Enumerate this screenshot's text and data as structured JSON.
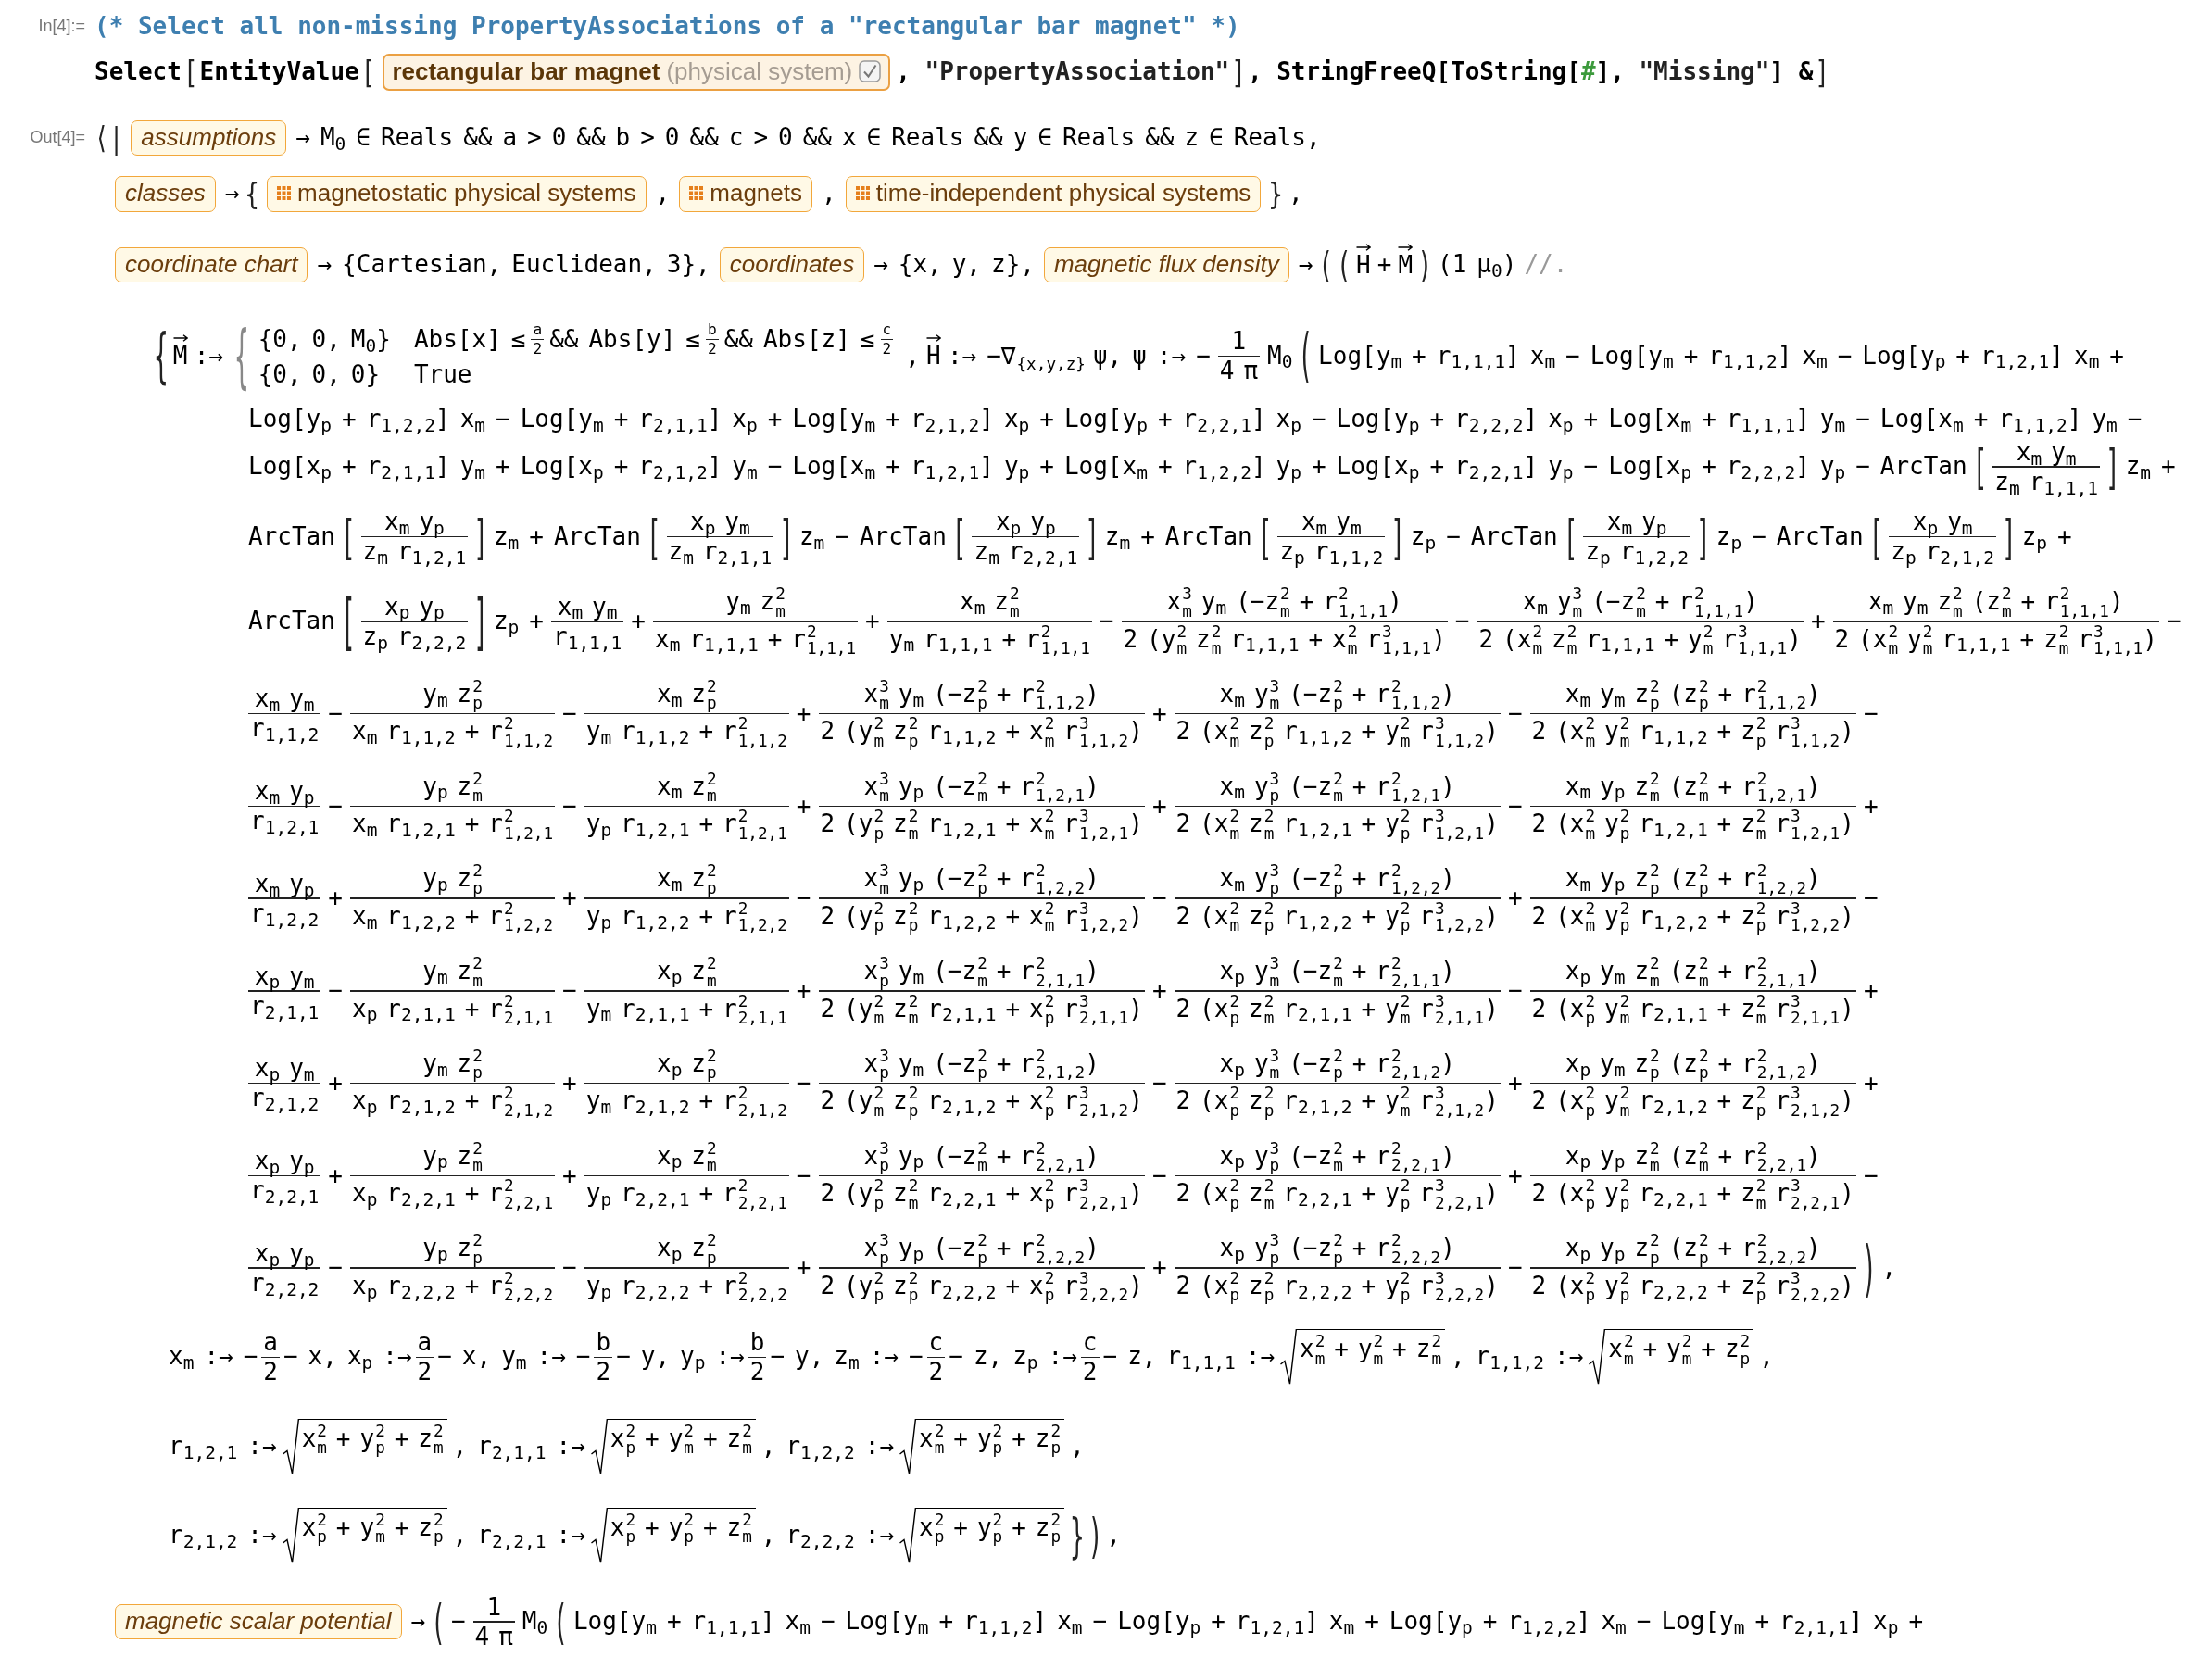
{
  "input_cell": {
    "label": "In[4]:=",
    "lines": [
      {
        "kind": "code",
        "tokens": [
          {
            "kind": "comment",
            "text": "(* Select all non-missing PropertyAssociations of a \"rectangular bar magnet\" *)"
          }
        ]
      },
      {
        "kind": "code",
        "tokens": [
          {
            "kind": "code",
            "text": "Select"
          },
          {
            "kind": "delim",
            "text": "["
          },
          {
            "kind": "code",
            "text": "EntityValue"
          },
          {
            "kind": "delim",
            "text": "["
          },
          {
            "kind": "instance",
            "label": "rectangular bar magnet",
            "qualifier": "(physical system)",
            "verified": true
          },
          {
            "kind": "code",
            "text": ","
          },
          {
            "kind": "string",
            "text": "\"PropertyAssociation\""
          },
          {
            "kind": "delim",
            "text": "]"
          },
          {
            "kind": "code",
            "text": ", StringFreeQ[ToString["
          },
          {
            "kind": "slot",
            "text": "#"
          },
          {
            "kind": "code",
            "text": "],"
          },
          {
            "kind": "string",
            "text": "\"Missing\""
          },
          {
            "kind": "code",
            "text": "] &"
          },
          {
            "kind": "delim",
            "text": "]"
          }
        ]
      }
    ]
  },
  "output_cell": {
    "label": "Out[4]=",
    "lines": [
      {
        "kind": "first",
        "tokens": [
          {
            "kind": "delim",
            "text": "⟨|"
          },
          {
            "kind": "property",
            "label": "assumptions"
          },
          {
            "kind": "text",
            "text": "→ M$_{0}$ ∈ Reals && a > 0 && b > 0 && c > 0 && x ∈ Reals && y ∈ Reals && z ∈ Reals,"
          }
        ]
      },
      {
        "kind": "rule",
        "tokens": [
          {
            "kind": "property",
            "label": "classes"
          },
          {
            "kind": "text",
            "text": "→"
          },
          {
            "kind": "delim",
            "text": "{"
          },
          {
            "kind": "class",
            "label": "magnetostatic physical systems"
          },
          {
            "kind": "text",
            "text": ","
          },
          {
            "kind": "class",
            "label": "magnets"
          },
          {
            "kind": "text",
            "text": ","
          },
          {
            "kind": "class",
            "label": "time-independent physical systems"
          },
          {
            "kind": "delim",
            "text": "}"
          },
          {
            "kind": "text",
            "text": ","
          }
        ]
      },
      {
        "kind": "rule",
        "tokens": [
          {
            "kind": "property",
            "label": "coordinate chart"
          },
          {
            "kind": "text",
            "text": "→ {Cartesian, Euclidean, 3},"
          },
          {
            "kind": "property",
            "label": "coordinates"
          },
          {
            "kind": "text",
            "text": "→ {x, y, z},"
          },
          {
            "kind": "property",
            "label": "magnetic flux density"
          },
          {
            "kind": "text",
            "text": "→"
          },
          {
            "kind": "delim",
            "text": "("
          },
          {
            "kind": "delim",
            "text": "("
          },
          {
            "kind": "vector",
            "text": "H"
          },
          {
            "kind": "text",
            "text": "+"
          },
          {
            "kind": "vector",
            "text": "M"
          },
          {
            "kind": "delim",
            "text": ")"
          },
          {
            "kind": "text",
            "text": "(1 μ$_{0}$)"
          },
          {
            "kind": "dim",
            "text": "//."
          }
        ]
      },
      {
        "kind": "assoc",
        "tokens": [
          {
            "kind": "delim",
            "text": "{"
          },
          {
            "kind": "vector",
            "text": "M"
          },
          {
            "kind": "text",
            "text": ":→"
          },
          {
            "kind": "piecewise",
            "open": "{",
            "cases": [
              {
                "value": "{0, 0, M$_{0}$}",
                "condition": [
                  {
                    "kind": "text",
                    "text": "Abs[x] ≤"
                  },
                  {
                    "kind": "frac",
                    "num": "a",
                    "den": "2"
                  },
                  {
                    "kind": "text",
                    "text": "&& Abs[y] ≤"
                  },
                  {
                    "kind": "frac",
                    "num": "b",
                    "den": "2"
                  },
                  {
                    "kind": "text",
                    "text": "&& Abs[z] ≤"
                  },
                  {
                    "kind": "frac",
                    "num": "c",
                    "den": "2"
                  }
                ]
              },
              {
                "value": "{0, 0, 0}",
                "condition": [
                  {
                    "kind": "text",
                    "text": "True"
                  }
                ]
              }
            ]
          },
          {
            "kind": "text",
            "text": ","
          },
          {
            "kind": "vector",
            "text": "H"
          },
          {
            "kind": "text",
            "text": ":→ −∇"
          },
          {
            "kind": "subscript",
            "text": "{x,y,z}"
          },
          {
            "kind": "text",
            "text": "ψ, ψ :→ −"
          },
          {
            "kind": "frac",
            "num": "1",
            "den": "4 π"
          },
          {
            "kind": "text",
            "text": "M$_{0}$"
          },
          {
            "kind": "delim",
            "text": "("
          },
          {
            "kind": "text",
            "text": "Log[y$_{m}$ + r$_{1,1,1}$] x$_{m}$ − Log[y$_{m}$ + r$_{1,1,2}$] x$_{m}$ − Log[y$_{p}$ + r$_{1,2,1}$] x$_{m}$ +"
          }
        ]
      },
      {
        "kind": "term",
        "tokens": [
          {
            "kind": "text",
            "text": "Log[y$_{p}$ + r$_{1,2,2}$] x$_{m}$ − Log[y$_{m}$ + r$_{2,1,1}$] x$_{p}$ + Log[y$_{m}$ + r$_{2,1,2}$] x$_{p}$ + Log[y$_{p}$ + r$_{2,2,1}$] x$_{p}$ − Log[y$_{p}$ + r$_{2,2,2}$] x$_{p}$ + Log[x$_{m}$ + r$_{1,1,1}$] y$_{m}$ − Log[x$_{m}$ + r$_{1,1,2}$] y$_{m}$ −"
          }
        ]
      },
      {
        "kind": "term",
        "tokens": [
          {
            "kind": "text",
            "text": "Log[x$_{p}$ + r$_{2,1,1}$] y$_{m}$ + Log[x$_{p}$ + r$_{2,1,2}$] y$_{m}$ − Log[x$_{m}$ + r$_{1,2,1}$] y$_{p}$ + Log[x$_{m}$ + r$_{1,2,2}$] y$_{p}$ + Log[x$_{p}$ + r$_{2,2,1}$] y$_{p}$ − Log[x$_{p}$ + r$_{2,2,2}$] y$_{p}$ − ArcTan"
          },
          {
            "kind": "delim",
            "text": "["
          },
          {
            "kind": "frac",
            "num": "x$_{m}$ y$_{m}$",
            "den": "z$_{m}$ r$_{1,1,1}$"
          },
          {
            "kind": "delim",
            "text": "]"
          },
          {
            "kind": "text",
            "text": "z$_{m}$ +"
          }
        ]
      },
      {
        "kind": "term",
        "tokens": [
          {
            "kind": "text",
            "text": "ArcTan"
          },
          {
            "kind": "delim",
            "text": "["
          },
          {
            "kind": "frac",
            "num": "x$_{m}$ y$_{p}$",
            "den": "z$_{m}$ r$_{1,2,1}$"
          },
          {
            "kind": "delim",
            "text": "]"
          },
          {
            "kind": "text",
            "text": "z$_{m}$ + ArcTan"
          },
          {
            "kind": "delim",
            "text": "["
          },
          {
            "kind": "frac",
            "num": "x$_{p}$ y$_{m}$",
            "den": "z$_{m}$ r$_{2,1,1}$"
          },
          {
            "kind": "delim",
            "text": "]"
          },
          {
            "kind": "text",
            "text": "z$_{m}$ − ArcTan"
          },
          {
            "kind": "delim",
            "text": "["
          },
          {
            "kind": "frac",
            "num": "x$_{p}$ y$_{p}$",
            "den": "z$_{m}$ r$_{2,2,1}$"
          },
          {
            "kind": "delim",
            "text": "]"
          },
          {
            "kind": "text",
            "text": "z$_{m}$ + ArcTan"
          },
          {
            "kind": "delim",
            "text": "["
          },
          {
            "kind": "frac",
            "num": "x$_{m}$ y$_{m}$",
            "den": "z$_{p}$ r$_{1,1,2}$"
          },
          {
            "kind": "delim",
            "text": "]"
          },
          {
            "kind": "text",
            "text": "z$_{p}$ − ArcTan"
          },
          {
            "kind": "delim",
            "text": "["
          },
          {
            "kind": "frac",
            "num": "x$_{m}$ y$_{p}$",
            "den": "z$_{p}$ r$_{1,2,2}$"
          },
          {
            "kind": "delim",
            "text": "]"
          },
          {
            "kind": "text",
            "text": "z$_{p}$ − ArcTan"
          },
          {
            "kind": "delim",
            "text": "["
          },
          {
            "kind": "frac",
            "num": "x$_{p}$ y$_{m}$",
            "den": "z$_{p}$ r$_{2,1,2}$"
          },
          {
            "kind": "delim",
            "text": "]"
          },
          {
            "kind": "text",
            "text": "z$_{p}$ +"
          }
        ]
      },
      {
        "kind": "term",
        "tokens": [
          {
            "kind": "text",
            "text": "ArcTan"
          },
          {
            "kind": "delim",
            "text": "["
          },
          {
            "kind": "frac",
            "num": "x$_{p}$ y$_{p}$",
            "den": "z$_{p}$ r$_{2,2,2}$"
          },
          {
            "kind": "delim",
            "text": "]"
          },
          {
            "kind": "text",
            "text": "z$_{p}$ +"
          },
          {
            "kind": "frac",
            "num": "x$_{m}$ y$_{m}$",
            "den": "r$_{1,1,1}$"
          },
          {
            "kind": "text",
            "text": "+"
          },
          {
            "kind": "frac",
            "num": "y$_{m}$ z$_{m}$$^{2}$",
            "den": "x$_{m}$ r$_{1,1,1}$ + r$_{1,1,1}$$^{2}$"
          },
          {
            "kind": "text",
            "text": "+"
          },
          {
            "kind": "frac",
            "num": "x$_{m}$ z$_{m}$$^{2}$",
            "den": "y$_{m}$ r$_{1,1,1}$ + r$_{1,1,1}$$^{2}$"
          },
          {
            "kind": "text",
            "text": "−"
          },
          {
            "kind": "frac",
            "num": "x$_{m}$$^{3}$ y$_{m}$ (−z$_{m}$$^{2}$ + r$_{1,1,1}$$^{2}$)",
            "den": "2 (y$_{m}$$^{2}$ z$_{m}$$^{2}$ r$_{1,1,1}$ + x$_{m}$$^{2}$ r$_{1,1,1}$$^{3}$)"
          },
          {
            "kind": "text",
            "text": "−"
          },
          {
            "kind": "frac",
            "num": "x$_{m}$ y$_{m}$$^{3}$ (−z$_{m}$$^{2}$ + r$_{1,1,1}$$^{2}$)",
            "den": "2 (x$_{m}$$^{2}$ z$_{m}$$^{2}$ r$_{1,1,1}$ + y$_{m}$$^{2}$ r$_{1,1,1}$$^{3}$)"
          },
          {
            "kind": "text",
            "text": "+"
          },
          {
            "kind": "frac",
            "num": "x$_{m}$ y$_{m}$ z$_{m}$$^{2}$ (z$_{m}$$^{2}$ + r$_{1,1,1}$$^{2}$)",
            "den": "2 (x$_{m}$$^{2}$ y$_{m}$$^{2}$ r$_{1,1,1}$ + z$_{m}$$^{2}$ r$_{1,1,1}$$^{3}$)"
          },
          {
            "kind": "text",
            "text": "−"
          }
        ]
      },
      {
        "kind": "term",
        "tokens": [
          {
            "kind": "frac",
            "num": "x$_{m}$ y$_{m}$",
            "den": "r$_{1,1,2}$"
          },
          {
            "kind": "text",
            "text": "−"
          },
          {
            "kind": "frac",
            "num": "y$_{m}$ z$_{p}$$^{2}$",
            "den": "x$_{m}$ r$_{1,1,2}$ + r$_{1,1,2}$$^{2}$"
          },
          {
            "kind": "text",
            "text": "−"
          },
          {
            "kind": "frac",
            "num": "x$_{m}$ z$_{p}$$^{2}$",
            "den": "y$_{m}$ r$_{1,1,2}$ + r$_{1,1,2}$$^{2}$"
          },
          {
            "kind": "text",
            "text": "+"
          },
          {
            "kind": "frac",
            "num": "x$_{m}$$^{3}$ y$_{m}$ (−z$_{p}$$^{2}$ + r$_{1,1,2}$$^{2}$)",
            "den": "2 (y$_{m}$$^{2}$ z$_{p}$$^{2}$ r$_{1,1,2}$ + x$_{m}$$^{2}$ r$_{1,1,2}$$^{3}$)"
          },
          {
            "kind": "text",
            "text": "+"
          },
          {
            "kind": "frac",
            "num": "x$_{m}$ y$_{m}$$^{3}$ (−z$_{p}$$^{2}$ + r$_{1,1,2}$$^{2}$)",
            "den": "2 (x$_{m}$$^{2}$ z$_{p}$$^{2}$ r$_{1,1,2}$ + y$_{m}$$^{2}$ r$_{1,1,2}$$^{3}$)"
          },
          {
            "kind": "text",
            "text": "−"
          },
          {
            "kind": "frac",
            "num": "x$_{m}$ y$_{m}$ z$_{p}$$^{2}$ (z$_{p}$$^{2}$ + r$_{1,1,2}$$^{2}$)",
            "den": "2 (x$_{m}$$^{2}$ y$_{m}$$^{2}$ r$_{1,1,2}$ + z$_{p}$$^{2}$ r$_{1,1,2}$$^{3}$)"
          },
          {
            "kind": "text",
            "text": "−"
          }
        ]
      },
      {
        "kind": "term",
        "tokens": [
          {
            "kind": "frac",
            "num": "x$_{m}$ y$_{p}$",
            "den": "r$_{1,2,1}$"
          },
          {
            "kind": "text",
            "text": "−"
          },
          {
            "kind": "frac",
            "num": "y$_{p}$ z$_{m}$$^{2}$",
            "den": "x$_{m}$ r$_{1,2,1}$ + r$_{1,2,1}$$^{2}$"
          },
          {
            "kind": "text",
            "text": "−"
          },
          {
            "kind": "frac",
            "num": "x$_{m}$ z$_{m}$$^{2}$",
            "den": "y$_{p}$ r$_{1,2,1}$ + r$_{1,2,1}$$^{2}$"
          },
          {
            "kind": "text",
            "text": "+"
          },
          {
            "kind": "frac",
            "num": "x$_{m}$$^{3}$ y$_{p}$ (−z$_{m}$$^{2}$ + r$_{1,2,1}$$^{2}$)",
            "den": "2 (y$_{p}$$^{2}$ z$_{m}$$^{2}$ r$_{1,2,1}$ + x$_{m}$$^{2}$ r$_{1,2,1}$$^{3}$)"
          },
          {
            "kind": "text",
            "text": "+"
          },
          {
            "kind": "frac",
            "num": "x$_{m}$ y$_{p}$$^{3}$ (−z$_{m}$$^{2}$ + r$_{1,2,1}$$^{2}$)",
            "den": "2 (x$_{m}$$^{2}$ z$_{m}$$^{2}$ r$_{1,2,1}$ + y$_{p}$$^{2}$ r$_{1,2,1}$$^{3}$)"
          },
          {
            "kind": "text",
            "text": "−"
          },
          {
            "kind": "frac",
            "num": "x$_{m}$ y$_{p}$ z$_{m}$$^{2}$ (z$_{m}$$^{2}$ + r$_{1,2,1}$$^{2}$)",
            "den": "2 (x$_{m}$$^{2}$ y$_{p}$$^{2}$ r$_{1,2,1}$ + z$_{m}$$^{2}$ r$_{1,2,1}$$^{3}$)"
          },
          {
            "kind": "text",
            "text": "+"
          }
        ]
      },
      {
        "kind": "term",
        "tokens": [
          {
            "kind": "frac",
            "num": "x$_{m}$ y$_{p}$",
            "den": "r$_{1,2,2}$"
          },
          {
            "kind": "text",
            "text": "+"
          },
          {
            "kind": "frac",
            "num": "y$_{p}$ z$_{p}$$^{2}$",
            "den": "x$_{m}$ r$_{1,2,2}$ + r$_{1,2,2}$$^{2}$"
          },
          {
            "kind": "text",
            "text": "+"
          },
          {
            "kind": "frac",
            "num": "x$_{m}$ z$_{p}$$^{2}$",
            "den": "y$_{p}$ r$_{1,2,2}$ + r$_{1,2,2}$$^{2}$"
          },
          {
            "kind": "text",
            "text": "−"
          },
          {
            "kind": "frac",
            "num": "x$_{m}$$^{3}$ y$_{p}$ (−z$_{p}$$^{2}$ + r$_{1,2,2}$$^{2}$)",
            "den": "2 (y$_{p}$$^{2}$ z$_{p}$$^{2}$ r$_{1,2,2}$ + x$_{m}$$^{2}$ r$_{1,2,2}$$^{3}$)"
          },
          {
            "kind": "text",
            "text": "−"
          },
          {
            "kind": "frac",
            "num": "x$_{m}$ y$_{p}$$^{3}$ (−z$_{p}$$^{2}$ + r$_{1,2,2}$$^{2}$)",
            "den": "2 (x$_{m}$$^{2}$ z$_{p}$$^{2}$ r$_{1,2,2}$ + y$_{p}$$^{2}$ r$_{1,2,2}$$^{3}$)"
          },
          {
            "kind": "text",
            "text": "+"
          },
          {
            "kind": "frac",
            "num": "x$_{m}$ y$_{p}$ z$_{p}$$^{2}$ (z$_{p}$$^{2}$ + r$_{1,2,2}$$^{2}$)",
            "den": "2 (x$_{m}$$^{2}$ y$_{p}$$^{2}$ r$_{1,2,2}$ + z$_{p}$$^{2}$ r$_{1,2,2}$$^{3}$)"
          },
          {
            "kind": "text",
            "text": "−"
          }
        ]
      },
      {
        "kind": "term",
        "tokens": [
          {
            "kind": "frac",
            "num": "x$_{p}$ y$_{m}$",
            "den": "r$_{2,1,1}$"
          },
          {
            "kind": "text",
            "text": "−"
          },
          {
            "kind": "frac",
            "num": "y$_{m}$ z$_{m}$$^{2}$",
            "den": "x$_{p}$ r$_{2,1,1}$ + r$_{2,1,1}$$^{2}$"
          },
          {
            "kind": "text",
            "text": "−"
          },
          {
            "kind": "frac",
            "num": "x$_{p}$ z$_{m}$$^{2}$",
            "den": "y$_{m}$ r$_{2,1,1}$ + r$_{2,1,1}$$^{2}$"
          },
          {
            "kind": "text",
            "text": "+"
          },
          {
            "kind": "frac",
            "num": "x$_{p}$$^{3}$ y$_{m}$ (−z$_{m}$$^{2}$ + r$_{2,1,1}$$^{2}$)",
            "den": "2 (y$_{m}$$^{2}$ z$_{m}$$^{2}$ r$_{2,1,1}$ + x$_{p}$$^{2}$ r$_{2,1,1}$$^{3}$)"
          },
          {
            "kind": "text",
            "text": "+"
          },
          {
            "kind": "frac",
            "num": "x$_{p}$ y$_{m}$$^{3}$ (−z$_{m}$$^{2}$ + r$_{2,1,1}$$^{2}$)",
            "den": "2 (x$_{p}$$^{2}$ z$_{m}$$^{2}$ r$_{2,1,1}$ + y$_{m}$$^{2}$ r$_{2,1,1}$$^{3}$)"
          },
          {
            "kind": "text",
            "text": "−"
          },
          {
            "kind": "frac",
            "num": "x$_{p}$ y$_{m}$ z$_{m}$$^{2}$ (z$_{m}$$^{2}$ + r$_{2,1,1}$$^{2}$)",
            "den": "2 (x$_{p}$$^{2}$ y$_{m}$$^{2}$ r$_{2,1,1}$ + z$_{m}$$^{2}$ r$_{2,1,1}$$^{3}$)"
          },
          {
            "kind": "text",
            "text": "+"
          }
        ]
      },
      {
        "kind": "term",
        "tokens": [
          {
            "kind": "frac",
            "num": "x$_{p}$ y$_{m}$",
            "den": "r$_{2,1,2}$"
          },
          {
            "kind": "text",
            "text": "+"
          },
          {
            "kind": "frac",
            "num": "y$_{m}$ z$_{p}$$^{2}$",
            "den": "x$_{p}$ r$_{2,1,2}$ + r$_{2,1,2}$$^{2}$"
          },
          {
            "kind": "text",
            "text": "+"
          },
          {
            "kind": "frac",
            "num": "x$_{p}$ z$_{p}$$^{2}$",
            "den": "y$_{m}$ r$_{2,1,2}$ + r$_{2,1,2}$$^{2}$"
          },
          {
            "kind": "text",
            "text": "−"
          },
          {
            "kind": "frac",
            "num": "x$_{p}$$^{3}$ y$_{m}$ (−z$_{p}$$^{2}$ + r$_{2,1,2}$$^{2}$)",
            "den": "2 (y$_{m}$$^{2}$ z$_{p}$$^{2}$ r$_{2,1,2}$ + x$_{p}$$^{2}$ r$_{2,1,2}$$^{3}$)"
          },
          {
            "kind": "text",
            "text": "−"
          },
          {
            "kind": "frac",
            "num": "x$_{p}$ y$_{m}$$^{3}$ (−z$_{p}$$^{2}$ + r$_{2,1,2}$$^{2}$)",
            "den": "2 (x$_{p}$$^{2}$ z$_{p}$$^{2}$ r$_{2,1,2}$ + y$_{m}$$^{2}$ r$_{2,1,2}$$^{3}$)"
          },
          {
            "kind": "text",
            "text": "+"
          },
          {
            "kind": "frac",
            "num": "x$_{p}$ y$_{m}$ z$_{p}$$^{2}$ (z$_{p}$$^{2}$ + r$_{2,1,2}$$^{2}$)",
            "den": "2 (x$_{p}$$^{2}$ y$_{m}$$^{2}$ r$_{2,1,2}$ + z$_{p}$$^{2}$ r$_{2,1,2}$$^{3}$)"
          },
          {
            "kind": "text",
            "text": "+"
          }
        ]
      },
      {
        "kind": "term",
        "tokens": [
          {
            "kind": "frac",
            "num": "x$_{p}$ y$_{p}$",
            "den": "r$_{2,2,1}$"
          },
          {
            "kind": "text",
            "text": "+"
          },
          {
            "kind": "frac",
            "num": "y$_{p}$ z$_{m}$$^{2}$",
            "den": "x$_{p}$ r$_{2,2,1}$ + r$_{2,2,1}$$^{2}$"
          },
          {
            "kind": "text",
            "text": "+"
          },
          {
            "kind": "frac",
            "num": "x$_{p}$ z$_{m}$$^{2}$",
            "den": "y$_{p}$ r$_{2,2,1}$ + r$_{2,2,1}$$^{2}$"
          },
          {
            "kind": "text",
            "text": "−"
          },
          {
            "kind": "frac",
            "num": "x$_{p}$$^{3}$ y$_{p}$ (−z$_{m}$$^{2}$ + r$_{2,2,1}$$^{2}$)",
            "den": "2 (y$_{p}$$^{2}$ z$_{m}$$^{2}$ r$_{2,2,1}$ + x$_{p}$$^{2}$ r$_{2,2,1}$$^{3}$)"
          },
          {
            "kind": "text",
            "text": "−"
          },
          {
            "kind": "frac",
            "num": "x$_{p}$ y$_{p}$$^{3}$ (−z$_{m}$$^{2}$ + r$_{2,2,1}$$^{2}$)",
            "den": "2 (x$_{p}$$^{2}$ z$_{m}$$^{2}$ r$_{2,2,1}$ + y$_{p}$$^{2}$ r$_{2,2,1}$$^{3}$)"
          },
          {
            "kind": "text",
            "text": "+"
          },
          {
            "kind": "frac",
            "num": "x$_{p}$ y$_{p}$ z$_{m}$$^{2}$ (z$_{m}$$^{2}$ + r$_{2,2,1}$$^{2}$)",
            "den": "2 (x$_{p}$$^{2}$ y$_{p}$$^{2}$ r$_{2,2,1}$ + z$_{m}$$^{2}$ r$_{2,2,1}$$^{3}$)"
          },
          {
            "kind": "text",
            "text": "−"
          }
        ]
      },
      {
        "kind": "term",
        "tokens": [
          {
            "kind": "frac",
            "num": "x$_{p}$ y$_{p}$",
            "den": "r$_{2,2,2}$"
          },
          {
            "kind": "text",
            "text": "−"
          },
          {
            "kind": "frac",
            "num": "y$_{p}$ z$_{p}$$^{2}$",
            "den": "x$_{p}$ r$_{2,2,2}$ + r$_{2,2,2}$$^{2}$"
          },
          {
            "kind": "text",
            "text": "−"
          },
          {
            "kind": "frac",
            "num": "x$_{p}$ z$_{p}$$^{2}$",
            "den": "y$_{p}$ r$_{2,2,2}$ + r$_{2,2,2}$$^{2}$"
          },
          {
            "kind": "text",
            "text": "+"
          },
          {
            "kind": "frac",
            "num": "x$_{p}$$^{3}$ y$_{p}$ (−z$_{p}$$^{2}$ + r$_{2,2,2}$$^{2}$)",
            "den": "2 (y$_{p}$$^{2}$ z$_{p}$$^{2}$ r$_{2,2,2}$ + x$_{p}$$^{2}$ r$_{2,2,2}$$^{3}$)"
          },
          {
            "kind": "text",
            "text": "+"
          },
          {
            "kind": "frac",
            "num": "x$_{p}$ y$_{p}$$^{3}$ (−z$_{p}$$^{2}$ + r$_{2,2,2}$$^{2}$)",
            "den": "2 (x$_{p}$$^{2}$ z$_{p}$$^{2}$ r$_{2,2,2}$ + y$_{p}$$^{2}$ r$_{2,2,2}$$^{3}$)"
          },
          {
            "kind": "text",
            "text": "−"
          },
          {
            "kind": "frac",
            "num": "x$_{p}$ y$_{p}$ z$_{p}$$^{2}$ (z$_{p}$$^{2}$ + r$_{2,2,2}$$^{2}$)",
            "den": "2 (x$_{p}$$^{2}$ y$_{p}$$^{2}$ r$_{2,2,2}$ + z$_{p}$$^{2}$ r$_{2,2,2}$$^{3}$)"
          },
          {
            "kind": "delim",
            "text": ")"
          },
          {
            "kind": "text",
            "text": ","
          }
        ]
      },
      {
        "kind": "def",
        "tokens": [
          {
            "kind": "text",
            "text": "x$_{m}$ :→ −"
          },
          {
            "kind": "frac",
            "num": "a",
            "den": "2"
          },
          {
            "kind": "text",
            "text": "− x, x$_{p}$ :→"
          },
          {
            "kind": "frac",
            "num": "a",
            "den": "2"
          },
          {
            "kind": "text",
            "text": "− x, y$_{m}$ :→ −"
          },
          {
            "kind": "frac",
            "num": "b",
            "den": "2"
          },
          {
            "kind": "text",
            "text": "− y, y$_{p}$ :→"
          },
          {
            "kind": "frac",
            "num": "b",
            "den": "2"
          },
          {
            "kind": "text",
            "text": "− y, z$_{m}$ :→ −"
          },
          {
            "kind": "frac",
            "num": "c",
            "den": "2"
          },
          {
            "kind": "text",
            "text": "− z, z$_{p}$ :→"
          },
          {
            "kind": "frac",
            "num": "c",
            "den": "2"
          },
          {
            "kind": "text",
            "text": "− z, r$_{1,1,1}$ :→"
          },
          {
            "kind": "sqrt",
            "text": "x$_{m}$$^{2}$ + y$_{m}$$^{2}$ + z$_{m}$$^{2}$"
          },
          {
            "kind": "text",
            "text": ", r$_{1,1,2}$ :→"
          },
          {
            "kind": "sqrt",
            "text": "x$_{m}$$^{2}$ + y$_{m}$$^{2}$ + z$_{p}$$^{2}$"
          },
          {
            "kind": "text",
            "text": ","
          }
        ]
      },
      {
        "kind": "def",
        "tokens": [
          {
            "kind": "text",
            "text": "r$_{1,2,1}$ :→"
          },
          {
            "kind": "sqrt",
            "text": "x$_{m}$$^{2}$ + y$_{p}$$^{2}$ + z$_{m}$$^{2}$"
          },
          {
            "kind": "text",
            "text": ", r$_{2,1,1}$ :→"
          },
          {
            "kind": "sqrt",
            "text": "x$_{p}$$^{2}$ + y$_{m}$$^{2}$ + z$_{m}$$^{2}$"
          },
          {
            "kind": "text",
            "text": ", r$_{1,2,2}$ :→"
          },
          {
            "kind": "sqrt",
            "text": "x$_{m}$$^{2}$ + y$_{p}$$^{2}$ + z$_{p}$$^{2}$"
          },
          {
            "kind": "text",
            "text": ","
          }
        ]
      },
      {
        "kind": "def",
        "tokens": [
          {
            "kind": "text",
            "text": "r$_{2,1,2}$ :→"
          },
          {
            "kind": "sqrt",
            "text": "x$_{p}$$^{2}$ + y$_{m}$$^{2}$ + z$_{p}$$^{2}$"
          },
          {
            "kind": "text",
            "text": ", r$_{2,2,1}$ :→"
          },
          {
            "kind": "sqrt",
            "text": "x$_{p}$$^{2}$ + y$_{p}$$^{2}$ + z$_{m}$$^{2}$"
          },
          {
            "kind": "text",
            "text": ", r$_{2,2,2}$ :→"
          },
          {
            "kind": "sqrt",
            "text": "x$_{p}$$^{2}$ + y$_{p}$$^{2}$ + z$_{p}$$^{2}$"
          },
          {
            "kind": "delim",
            "text": "}"
          },
          {
            "kind": "delim",
            "text": ")"
          },
          {
            "kind": "text",
            "text": ","
          }
        ]
      },
      {
        "kind": "rule",
        "tokens": [
          {
            "kind": "property",
            "label": "magnetic scalar potential"
          },
          {
            "kind": "text",
            "text": "→"
          },
          {
            "kind": "delim",
            "text": "("
          },
          {
            "kind": "text",
            "text": "−"
          },
          {
            "kind": "frac",
            "num": "1",
            "den": "4 π"
          },
          {
            "kind": "text",
            "text": "M$_{0}$"
          },
          {
            "kind": "delim",
            "text": "("
          },
          {
            "kind": "text",
            "text": "Log[y$_{m}$ + r$_{1,1,1}$] x$_{m}$ − Log[y$_{m}$ + r$_{1,1,2}$] x$_{m}$ − Log[y$_{p}$ + r$_{1,2,1}$] x$_{m}$ + Log[y$_{p}$ + r$_{1,2,2}$] x$_{m}$ − Log[y$_{m}$ + r$_{2,1,1}$] x$_{p}$ +"
          }
        ]
      }
    ]
  }
}
